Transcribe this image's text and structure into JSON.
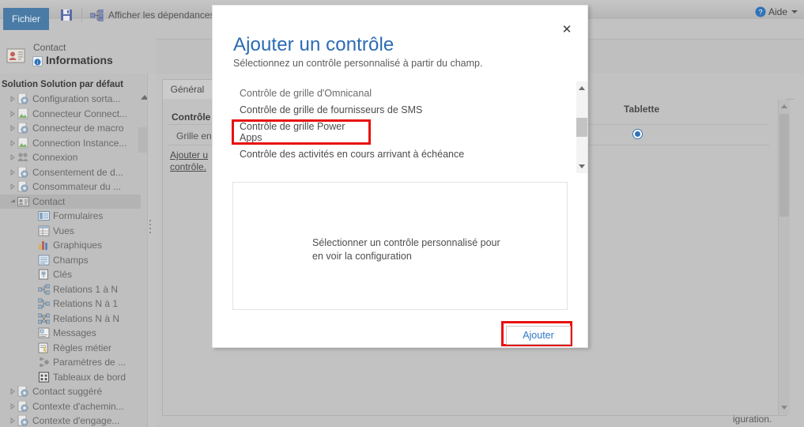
{
  "window": {
    "file_tab": "Fichier",
    "save_icon": "save-icon",
    "dependencies_label": "Afficher les dépendances",
    "dependencies_icon": "dependencies-icon",
    "help_label": "Aide",
    "help_icon": "help-circle-icon"
  },
  "entity": {
    "breadcrumb": "Contact",
    "title": "Informations",
    "entity_icon": "contact-card-icon",
    "info_icon": "information-icon",
    "solution_label": "Solution Solution par défaut"
  },
  "tree": {
    "items": [
      {
        "label": "Configuration sorta...",
        "icon": "entity-icon",
        "expander": "closed",
        "indent": 0,
        "selected": false
      },
      {
        "label": "Connecteur Connect...",
        "icon": "image-entity-icon",
        "expander": "closed",
        "indent": 0,
        "selected": false
      },
      {
        "label": "Connecteur de macro",
        "icon": "entity-icon",
        "expander": "closed",
        "indent": 0,
        "selected": false
      },
      {
        "label": "Connection Instance...",
        "icon": "image-entity-icon",
        "expander": "closed",
        "indent": 0,
        "selected": false
      },
      {
        "label": "Connexion",
        "icon": "connection-icon",
        "expander": "closed",
        "indent": 0,
        "selected": false
      },
      {
        "label": "Consentement de d...",
        "icon": "entity-icon",
        "expander": "closed",
        "indent": 0,
        "selected": false
      },
      {
        "label": "Consommateur du ...",
        "icon": "entity-icon",
        "expander": "closed",
        "indent": 0,
        "selected": false
      },
      {
        "label": "Contact",
        "icon": "contact-entity-icon",
        "expander": "open",
        "indent": 0,
        "selected": true
      },
      {
        "label": "Formulaires",
        "icon": "forms-icon",
        "expander": "none",
        "indent": 1,
        "selected": false
      },
      {
        "label": "Vues",
        "icon": "views-icon",
        "expander": "none",
        "indent": 1,
        "selected": false
      },
      {
        "label": "Graphiques",
        "icon": "charts-icon",
        "expander": "none",
        "indent": 1,
        "selected": false
      },
      {
        "label": "Champs",
        "icon": "fields-icon",
        "expander": "none",
        "indent": 1,
        "selected": false
      },
      {
        "label": "Clés",
        "icon": "keys-icon",
        "expander": "none",
        "indent": 1,
        "selected": false
      },
      {
        "label": "Relations 1 à N",
        "icon": "relations-1n-icon",
        "expander": "none",
        "indent": 1,
        "selected": false
      },
      {
        "label": "Relations N à 1",
        "icon": "relations-n1-icon",
        "expander": "none",
        "indent": 1,
        "selected": false
      },
      {
        "label": "Relations N à N",
        "icon": "relations-nn-icon",
        "expander": "none",
        "indent": 1,
        "selected": false
      },
      {
        "label": "Messages",
        "icon": "messages-icon",
        "expander": "none",
        "indent": 1,
        "selected": false
      },
      {
        "label": "Règles métier",
        "icon": "business-rules-icon",
        "expander": "none",
        "indent": 1,
        "selected": false
      },
      {
        "label": "Paramètres de ...",
        "icon": "hierarchy-settings-icon",
        "expander": "none",
        "indent": 1,
        "selected": false
      },
      {
        "label": "Tableaux de bord",
        "icon": "dashboards-icon",
        "expander": "none",
        "indent": 1,
        "selected": false
      },
      {
        "label": "Contact suggéré",
        "icon": "entity-icon",
        "expander": "closed",
        "indent": 0,
        "selected": false
      },
      {
        "label": "Contexte d'achemin...",
        "icon": "entity-icon",
        "expander": "closed",
        "indent": 0,
        "selected": false
      },
      {
        "label": "Contexte d'engage...",
        "icon": "entity-icon",
        "expander": "closed",
        "indent": 0,
        "selected": false
      }
    ]
  },
  "content": {
    "tab_general": "Général",
    "controls_heading": "Contrôle",
    "grid_row_label": "Grille en",
    "add_control_link": "Ajouter u contrôle.",
    "column_tablette": "Tablette",
    "trailing_text": "iguration."
  },
  "modal": {
    "title": "Ajouter un contrôle",
    "subtitle": "Sélectionnez un contrôle personnalisé à partir du champ.",
    "close_icon": "close-icon",
    "scroll_up_icon": "scroll-up-arrow-icon",
    "scroll_down_icon": "scroll-down-arrow-icon",
    "options": [
      {
        "label": "Contrôle de grille d'Omnicanal",
        "highlighted": false,
        "clipped": true
      },
      {
        "label": "Contrôle de grille de fournisseurs de SMS",
        "highlighted": false,
        "clipped": false
      },
      {
        "label": "Contrôle de grille Power Apps",
        "highlighted": true,
        "clipped": false
      },
      {
        "label": "Contrôle des activités en cours arrivant à échéance",
        "highlighted": false,
        "clipped": false
      }
    ],
    "preview_text": "Sélectionner un contrôle personnalisé pour en voir la configuration",
    "add_button": "Ajouter"
  },
  "colors": {
    "highlight_red": "#e8110f",
    "title_blue": "#2a6bb5",
    "link_blue": "#2f78c4",
    "file_tab_blue": "#4a7ba6",
    "radio_blue": "#2f72b8"
  }
}
